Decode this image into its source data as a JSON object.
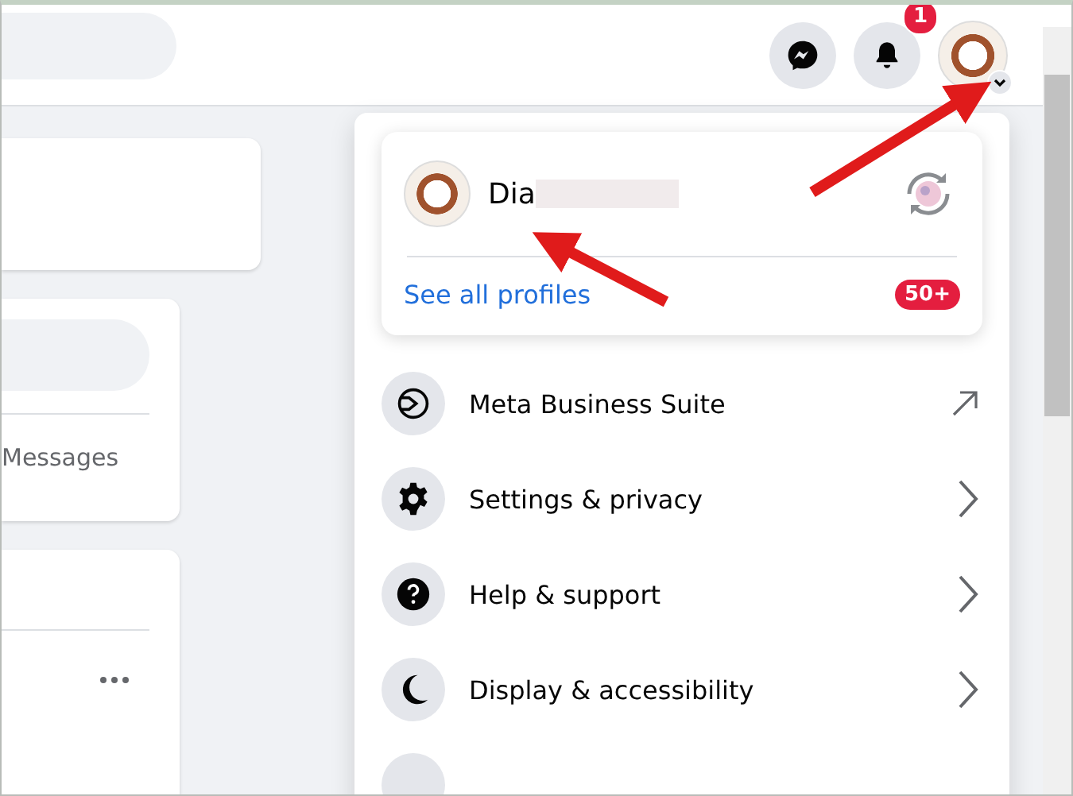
{
  "top_bar": {
    "notification_count": "1"
  },
  "left_column": {
    "messages_label": "Messages"
  },
  "account_menu": {
    "profile": {
      "name": "Dia",
      "link": "See all profiles",
      "badge": "50+"
    },
    "items": [
      {
        "label": "Meta Business Suite",
        "kind": "external"
      },
      {
        "label": "Settings & privacy",
        "kind": "submenu"
      },
      {
        "label": "Help & support",
        "kind": "submenu"
      },
      {
        "label": "Display & accessibility",
        "kind": "submenu"
      }
    ]
  }
}
